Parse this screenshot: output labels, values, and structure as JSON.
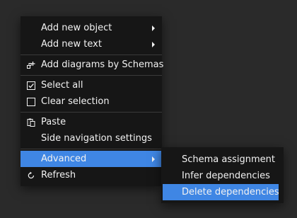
{
  "colors": {
    "background": "#2a2a2a",
    "menu_background": "#161616",
    "highlight": "#3f86e4",
    "text": "#f2f2f2",
    "separator": "#3a3a3a"
  },
  "context_menu": {
    "items": [
      {
        "label": "Add new object",
        "has_submenu": true
      },
      {
        "label": "Add new text",
        "has_submenu": true
      },
      {
        "label": "Add diagrams by Schemas",
        "icon": "add-diagram-icon"
      },
      {
        "label": "Select all",
        "icon": "checkbox-checked-icon"
      },
      {
        "label": "Clear selection",
        "icon": "checkbox-empty-icon"
      },
      {
        "label": "Paste",
        "icon": "paste-icon"
      },
      {
        "label": "Side navigation settings"
      },
      {
        "label": "Advanced",
        "has_submenu": true,
        "highlighted": true
      },
      {
        "label": "Refresh",
        "icon": "refresh-icon"
      }
    ]
  },
  "advanced_submenu": {
    "items": [
      {
        "label": "Schema assignment"
      },
      {
        "label": "Infer dependencies"
      },
      {
        "label": "Delete dependencies",
        "highlighted": true
      }
    ]
  }
}
